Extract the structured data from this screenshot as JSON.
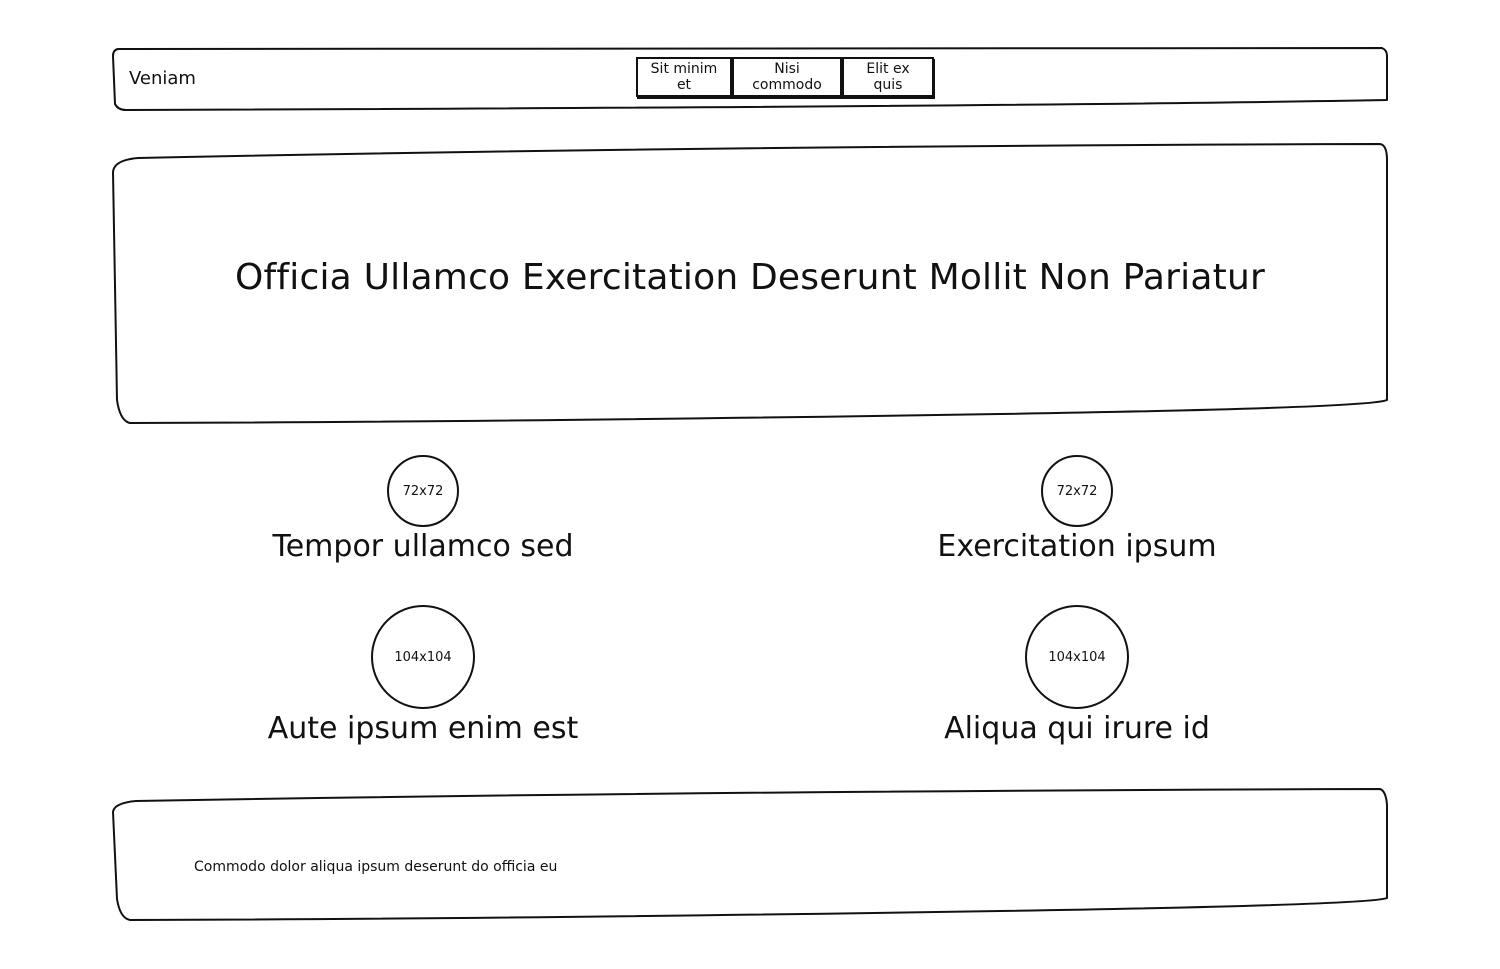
{
  "header": {
    "brand": "Veniam",
    "nav": [
      {
        "label": "Sit minim et"
      },
      {
        "label": "Nisi commodo"
      },
      {
        "label": "Elit ex quis"
      }
    ]
  },
  "hero": {
    "title": "Officia Ullamco Exercitation Deserunt Mollit Non Pariatur"
  },
  "features": [
    {
      "image_label": "72x72",
      "label": "Tempor ullamco sed"
    },
    {
      "image_label": "72x72",
      "label": "Exercitation ipsum"
    },
    {
      "image_label": "104x104",
      "label": "Aute ipsum enim est"
    },
    {
      "image_label": "104x104",
      "label": "Aliqua qui irure id"
    }
  ],
  "footer": {
    "text": "Commodo dolor aliqua ipsum deserunt do officia eu"
  }
}
